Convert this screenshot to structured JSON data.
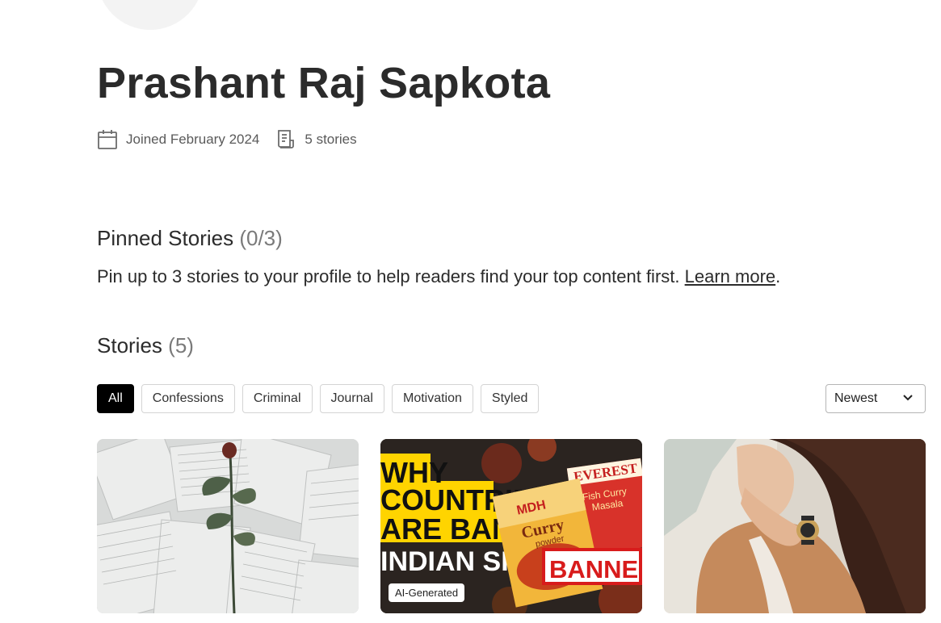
{
  "profile": {
    "name": "Prashant Raj Sapkota",
    "joined": "Joined February 2024",
    "story_count": "5 stories"
  },
  "pinned": {
    "title": "Pinned Stories",
    "count": "(0/3)",
    "description": "Pin up to 3 stories to your profile to help readers find your top content first.",
    "learn_more": "Learn more",
    "period": "."
  },
  "stories": {
    "title": "Stories",
    "count": "(5)",
    "filters": [
      "All",
      "Confessions",
      "Criminal",
      "Journal",
      "Motivation",
      "Styled"
    ],
    "active_filter": "All",
    "sort": "Newest",
    "cards": [
      {
        "image": "rose-on-book-pages"
      },
      {
        "image": "indian-spice-ban-thumbnail",
        "headline_lines": [
          "WHY",
          "COUNTRIES",
          "ARE BANNING",
          "INDIAN SPICE"
        ],
        "banner": "BANNED",
        "product1": "Curry",
        "product1_sub": "powder",
        "product1_brand": "MDH",
        "product2_brand": "EVEREST",
        "product2": "Fish Curry",
        "product2_sub": "Masala",
        "badge": "AI-Generated"
      },
      {
        "image": "woman-hands-on-face"
      }
    ]
  },
  "colors": {
    "active_chip": "#000000",
    "banned_red": "#d81b1b",
    "headline_yellow": "#ffd400"
  }
}
